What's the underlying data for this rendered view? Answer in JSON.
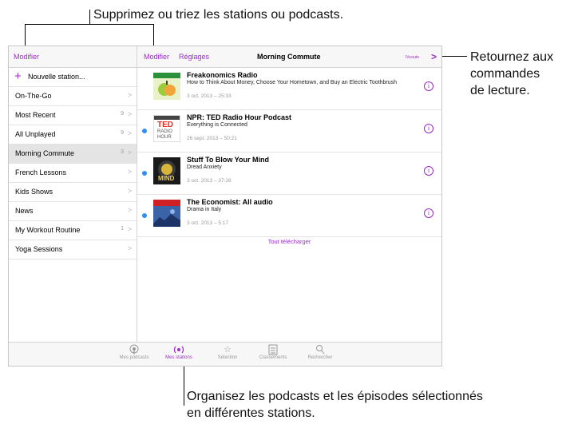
{
  "callouts": {
    "top": "Supprimez ou triez les stations ou podcasts.",
    "right": [
      "Retournez aux",
      "commandes",
      "de lecture."
    ],
    "bottom": [
      "Organisez les podcasts et les épisodes sélectionnés",
      "en différentes stations."
    ]
  },
  "sidebar": {
    "edit_label": "Modifier",
    "new_station_label": "Nouvelle station...",
    "items": [
      {
        "label": "On-The-Go",
        "count": ""
      },
      {
        "label": "Most Recent",
        "count": "9"
      },
      {
        "label": "All Unplayed",
        "count": "9"
      },
      {
        "label": "Morning Commute",
        "count": "3"
      },
      {
        "label": "French Lessons",
        "count": ""
      },
      {
        "label": "Kids Shows",
        "count": ""
      },
      {
        "label": "News",
        "count": ""
      },
      {
        "label": "My Workout Routine",
        "count": "1"
      },
      {
        "label": "Yoga Sessions",
        "count": ""
      }
    ]
  },
  "header": {
    "edit_label": "Modifier",
    "settings_label": "Réglages",
    "title": "Morning Commute",
    "now_playing_label": "l'écoute"
  },
  "episodes": [
    {
      "title": "Freakonomics Radio",
      "subtitle": "How to Think About Money, Choose Your Hometown, and Buy an Electric Toothbrush",
      "date": "3 oct. 2013 – 25:33",
      "unplayed": false
    },
    {
      "title": "NPR: TED Radio Hour Podcast",
      "subtitle": "Everything is Connected",
      "date": "26 sept. 2013 – 50:21",
      "unplayed": true
    },
    {
      "title": "Stuff To Blow Your Mind",
      "subtitle": "Dread Anxiety",
      "date": "3 oct. 2013 – 37:28",
      "unplayed": true
    },
    {
      "title": "The Economist: All audio",
      "subtitle": "Drama in Italy",
      "date": "3 oct. 2013 – 5:17",
      "unplayed": true
    }
  ],
  "artwork": {
    "ted_lines": [
      "TED",
      "RADIO",
      "HOUR"
    ],
    "mind_text": "MIND"
  },
  "download_all_label": "Tout télécharger",
  "tabs": [
    {
      "label": "Mes podcasts",
      "icon": "podcast-icon"
    },
    {
      "label": "Mes stations",
      "icon": "station-icon"
    },
    {
      "label": "Sélection",
      "icon": "star-icon"
    },
    {
      "label": "Classements",
      "icon": "list-icon"
    },
    {
      "label": "Rechercher",
      "icon": "search-icon"
    }
  ],
  "colors": {
    "accent": "#9b2dc6",
    "unplayed_dot": "#2f8ff1"
  }
}
